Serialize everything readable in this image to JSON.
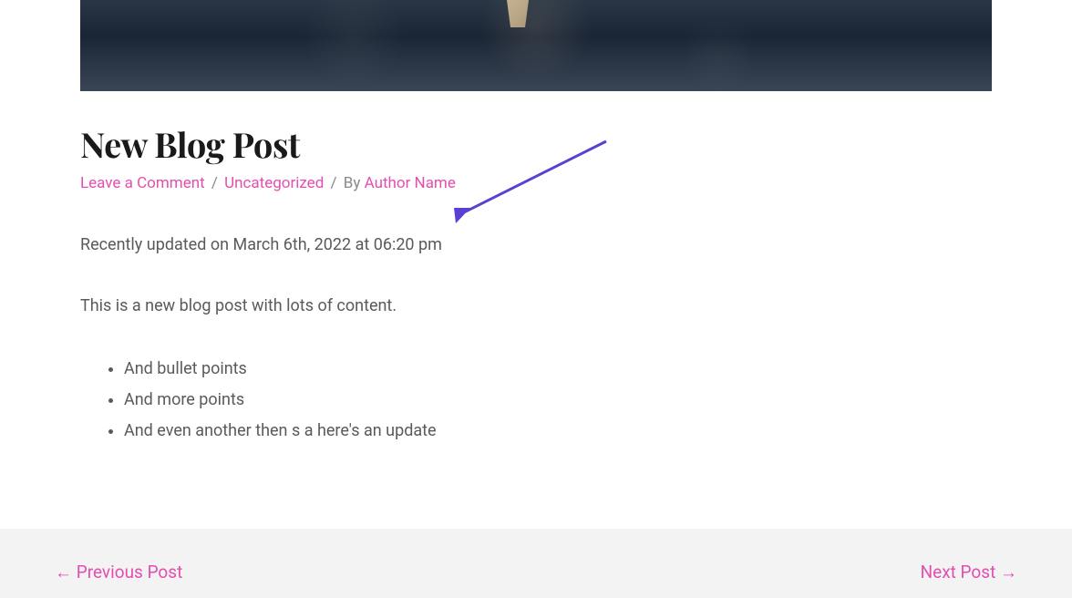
{
  "post": {
    "title": "New Blog Post",
    "meta": {
      "comment_link": "Leave a Comment",
      "category": "Uncategorized",
      "by_text": "By",
      "author": "Author Name"
    },
    "updated": "Recently updated on March 6th, 2022 at 06:20 pm",
    "content": "This is a new blog post with lots of content.",
    "bullets": [
      "And bullet points",
      "And more points",
      "And even another then s a here's an update"
    ]
  },
  "nav": {
    "prev": "← Previous Post",
    "next": "Next Post →"
  }
}
